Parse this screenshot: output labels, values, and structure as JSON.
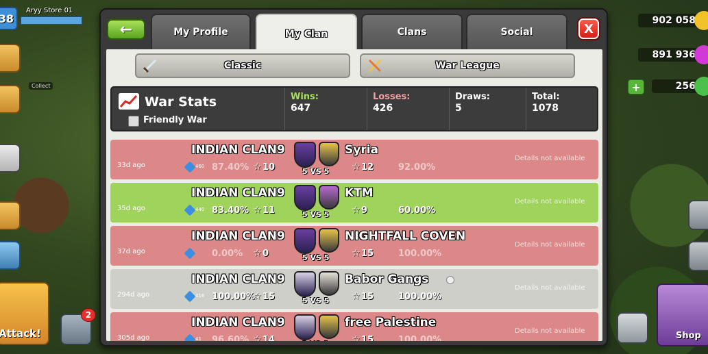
{
  "player": {
    "level": "38",
    "name": "Aryy Store 01"
  },
  "resources": {
    "gold": "902 058",
    "elixir": "891 936",
    "gems": "256"
  },
  "collect_label": "Collect",
  "attack_label": "Attack!",
  "shield_badge": "2",
  "shop_label": "Shop",
  "tabs": [
    {
      "label": "My Profile",
      "active": false
    },
    {
      "label": "My Clan",
      "active": true
    },
    {
      "label": "Clans",
      "active": false
    },
    {
      "label": "Social",
      "active": false
    }
  ],
  "close_label": "X",
  "modes": {
    "classic": "Classic",
    "war_league": "War League"
  },
  "war_stats": {
    "title": "War Stats",
    "friendly_war_label": "Friendly War",
    "wins_label": "Wins:",
    "wins": "647",
    "losses_label": "Losses:",
    "losses": "426",
    "draws_label": "Draws:",
    "draws": "5",
    "total_label": "Total:",
    "total": "1078",
    "colors": {
      "wins": "#a6e05c",
      "losses": "#f0a0a0",
      "draws": "#ffffff",
      "total": "#ffffff"
    }
  },
  "wars": [
    {
      "result": "loss",
      "ago": "33d ago",
      "clan": "INDIAN CLAN9",
      "league_num": "460",
      "clan_pct": "87.40%",
      "clan_stars": "10",
      "vs": "5 VS 5",
      "opponent": "Syria",
      "opp_stars": "12",
      "opp_pct": "92.00%",
      "details": "Details not available"
    },
    {
      "result": "win",
      "ago": "35d ago",
      "clan": "INDIAN CLAN9",
      "league_num": "440",
      "clan_pct": "83.40%",
      "clan_stars": "11",
      "vs": "5 VS 5",
      "opponent": "KTM",
      "opp_stars": "9",
      "opp_pct": "60.00%",
      "details": "Details not available"
    },
    {
      "result": "loss",
      "ago": "37d ago",
      "clan": "INDIAN CLAN9",
      "league_num": "",
      "clan_pct": "0.00%",
      "clan_stars": "0",
      "vs": "5 VS 5",
      "opponent": "NIGHTFALL COVEN",
      "opp_stars": "15",
      "opp_pct": "100.00%",
      "details": "Details not available"
    },
    {
      "result": "draw",
      "ago": "294d ago",
      "clan": "INDIAN CLAN9",
      "league_num": "416",
      "clan_pct": "100.00%",
      "clan_stars": "15",
      "vs": "5 VS 5",
      "opponent": "Babor Gangs",
      "opp_stars": "15",
      "opp_pct": "100.00%",
      "details": "Details not available"
    },
    {
      "result": "loss",
      "ago": "305d ago",
      "clan": "INDIAN CLAN9",
      "league_num": "41",
      "clan_pct": "96.60%",
      "clan_stars": "14",
      "vs": "5 VS 5",
      "opponent": "free Palestine",
      "opp_stars": "15",
      "opp_pct": "100.00%",
      "details": "Details not available"
    }
  ]
}
